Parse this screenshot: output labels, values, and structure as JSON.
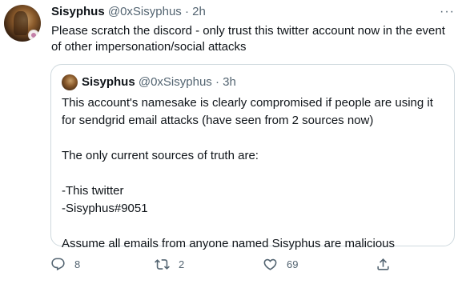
{
  "tweet": {
    "author_name": "Sisyphus",
    "author_handle": "@0xSisyphus",
    "separator": "·",
    "time": "2h",
    "more_label": "···",
    "text": "Please scratch the discord - only trust this twitter account now in the event of other impersonation/social attacks"
  },
  "quote": {
    "author_name": "Sisyphus",
    "author_handle": "@0xSisyphus",
    "separator": "·",
    "time": "3h",
    "paragraphs": [
      "This account's namesake is clearly compromised if people are using it for sendgrid email attacks (have seen from 2 sources now)",
      "The only current sources of truth are:",
      "-This twitter",
      "-Sisyphus#9051",
      "Assume all emails from anyone named Sisyphus are malicious"
    ]
  },
  "actions": {
    "replies": "8",
    "retweets": "2",
    "likes": "69"
  },
  "icons": {
    "reply": "reply-icon",
    "retweet": "retweet-icon",
    "like": "heart-icon",
    "share": "share-icon",
    "more": "more-icon"
  }
}
